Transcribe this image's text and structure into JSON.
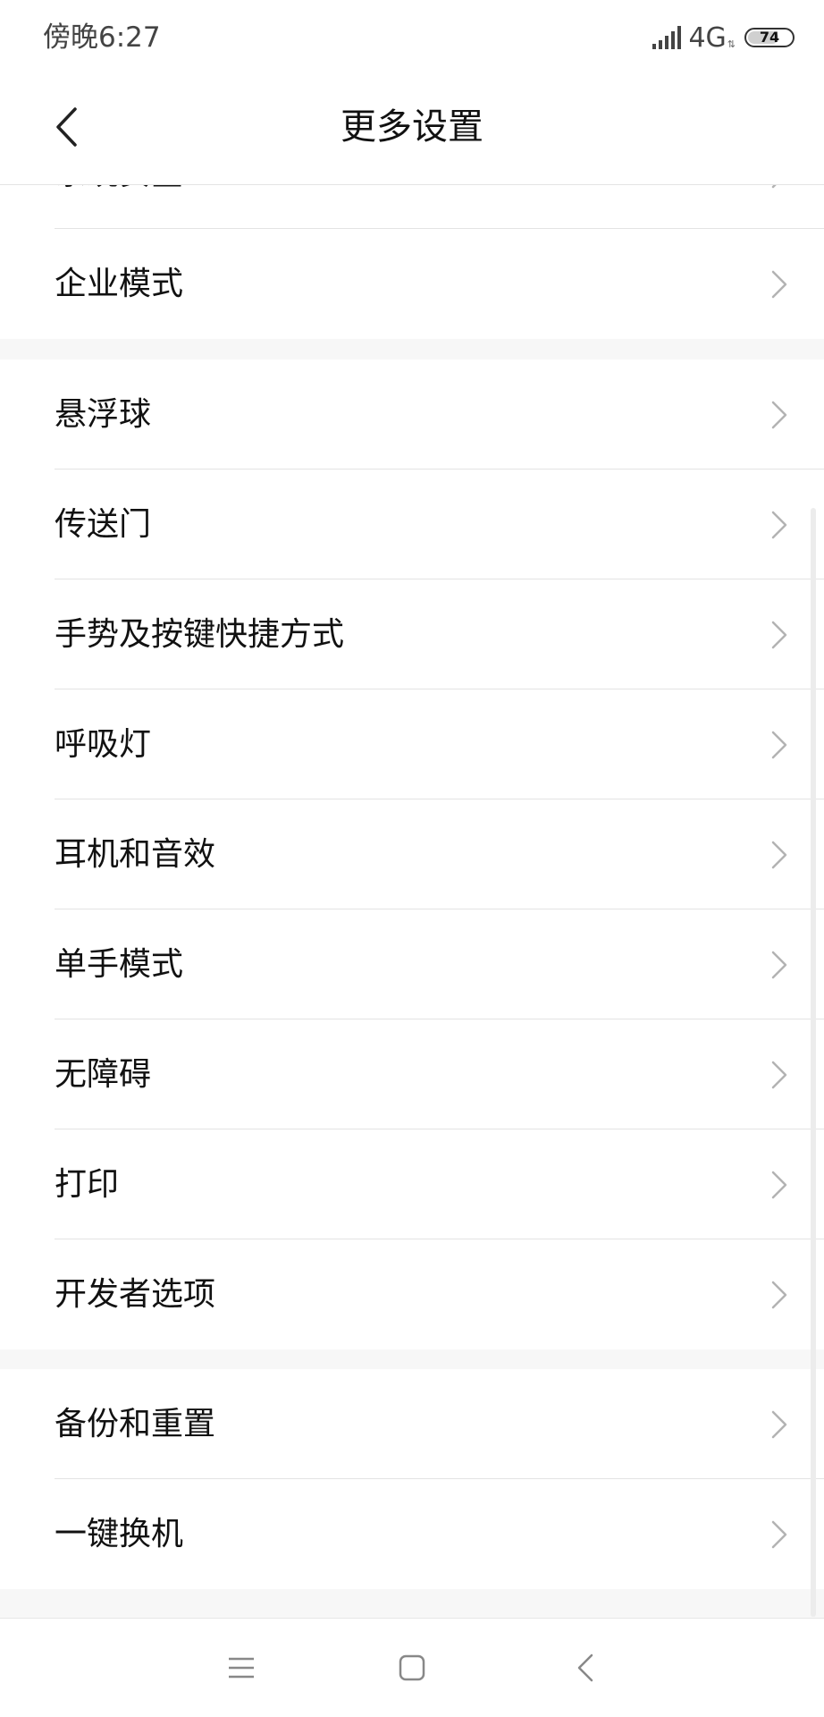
{
  "status_bar": {
    "time": "傍晚6:27",
    "network": "4G",
    "battery": "74",
    "battery_level": 0.74,
    "icons": [
      "signal-icon",
      "network-activity-icon",
      "battery-icon"
    ]
  },
  "header": {
    "title": "更多设置",
    "back_icon": "back-arrow-icon"
  },
  "groups": [
    {
      "items": [
        {
          "label": "系统安全",
          "partially_visible": true
        },
        {
          "label": "企业模式"
        }
      ]
    },
    {
      "items": [
        {
          "label": "悬浮球"
        },
        {
          "label": "传送门"
        },
        {
          "label": "手势及按键快捷方式"
        },
        {
          "label": "呼吸灯"
        },
        {
          "label": "耳机和音效"
        },
        {
          "label": "单手模式"
        },
        {
          "label": "无障碍"
        },
        {
          "label": "打印"
        },
        {
          "label": "开发者选项"
        }
      ]
    },
    {
      "items": [
        {
          "label": "备份和重置"
        },
        {
          "label": "一键换机"
        }
      ]
    }
  ],
  "row_icon": "chevron-right-icon",
  "nav_bar": {
    "buttons": [
      "menu-icon",
      "home-icon",
      "back-icon"
    ]
  },
  "colors": {
    "background": "#ffffff",
    "section_gap": "#f7f7f7",
    "divider": "#e3e3e3",
    "chevron": "#b3b3b3",
    "text": "#111111"
  }
}
